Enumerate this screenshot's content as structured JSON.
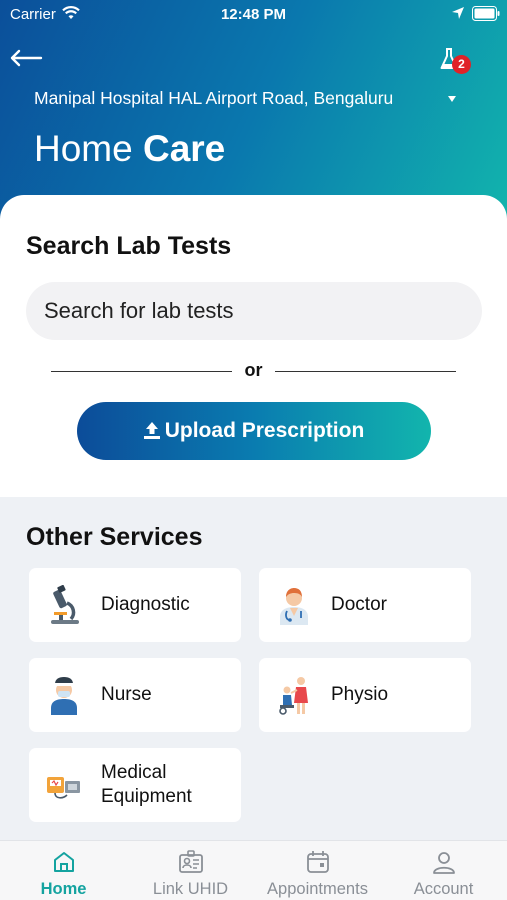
{
  "status_bar": {
    "carrier": "Carrier",
    "time": "12:48 PM"
  },
  "header": {
    "back_icon": "back-arrow-icon",
    "cart_icon": "flask-icon",
    "cart_count": "2",
    "hospital": "Manipal Hospital HAL Airport Road, Bengaluru",
    "title_light": "Home ",
    "title_bold": "Care"
  },
  "search": {
    "heading": "Search Lab Tests",
    "placeholder": "Search for lab tests",
    "or_text": "or",
    "upload_label": "Upload Prescription"
  },
  "services": {
    "heading": "Other Services",
    "items": [
      {
        "label": "Diagnostic",
        "icon": "microscope-icon"
      },
      {
        "label": "Doctor",
        "icon": "doctor-icon"
      },
      {
        "label": "Nurse",
        "icon": "nurse-icon"
      },
      {
        "label": "Physio",
        "icon": "physio-icon"
      },
      {
        "label": "Medical\nEquipment",
        "icon": "medical-equipment-icon"
      }
    ]
  },
  "tabs": [
    {
      "label": "Home",
      "icon": "home-icon",
      "active": true
    },
    {
      "label": "Link UHID",
      "icon": "id-card-icon",
      "active": false
    },
    {
      "label": "Appointments",
      "icon": "calendar-icon",
      "active": false
    },
    {
      "label": "Account",
      "icon": "person-icon",
      "active": false
    }
  ],
  "colors": {
    "gradient_start": "#0b4f9a",
    "gradient_end": "#12b5ad",
    "accent": "#14a3a0",
    "badge": "#e02228"
  }
}
